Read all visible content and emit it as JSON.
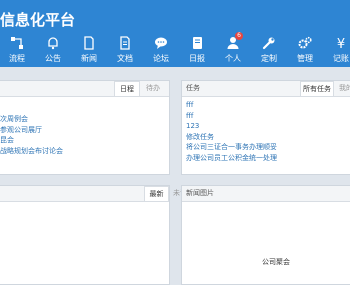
{
  "header": {
    "title": "信息化平台",
    "nav": [
      {
        "label": "流程",
        "icon": "workflow-icon"
      },
      {
        "label": "公告",
        "icon": "bell-icon"
      },
      {
        "label": "新闻",
        "icon": "document-icon"
      },
      {
        "label": "文档",
        "icon": "folder-doc-icon"
      },
      {
        "label": "论坛",
        "icon": "chat-icon"
      },
      {
        "label": "日报",
        "icon": "book-icon"
      },
      {
        "label": "个人",
        "icon": "user-icon",
        "badge": "6"
      },
      {
        "label": "定制",
        "icon": "wrench-icon"
      },
      {
        "label": "管理",
        "icon": "gears-icon"
      },
      {
        "label": "记账",
        "icon": "yen-icon"
      }
    ]
  },
  "schedule_panel": {
    "tabs": [
      "日程",
      "待办"
    ],
    "active_tab": "日程",
    "items": [
      "次周例会",
      "参观公司展厅",
      "昆会",
      "战略规划会布讨论会"
    ]
  },
  "task_panel": {
    "title": "任务",
    "tabs": [
      "所有任务",
      "我的"
    ],
    "active_tab": "所有任务",
    "items": [
      "fff",
      "fff",
      "123",
      "修改任务",
      "将公司三证合一事务办理顺妥",
      "办理公司员工公积金统一处理"
    ]
  },
  "news_panel": {
    "tabs": [
      "最新",
      "未读"
    ],
    "active_tab": "最新",
    "items": []
  },
  "picture_panel": {
    "title": "新闻图片",
    "caption": "公司聚会"
  },
  "colors": {
    "header": "#2e85d3",
    "link": "#2e74b5",
    "badge": "#e8463f",
    "background": "#dfe5ec"
  }
}
